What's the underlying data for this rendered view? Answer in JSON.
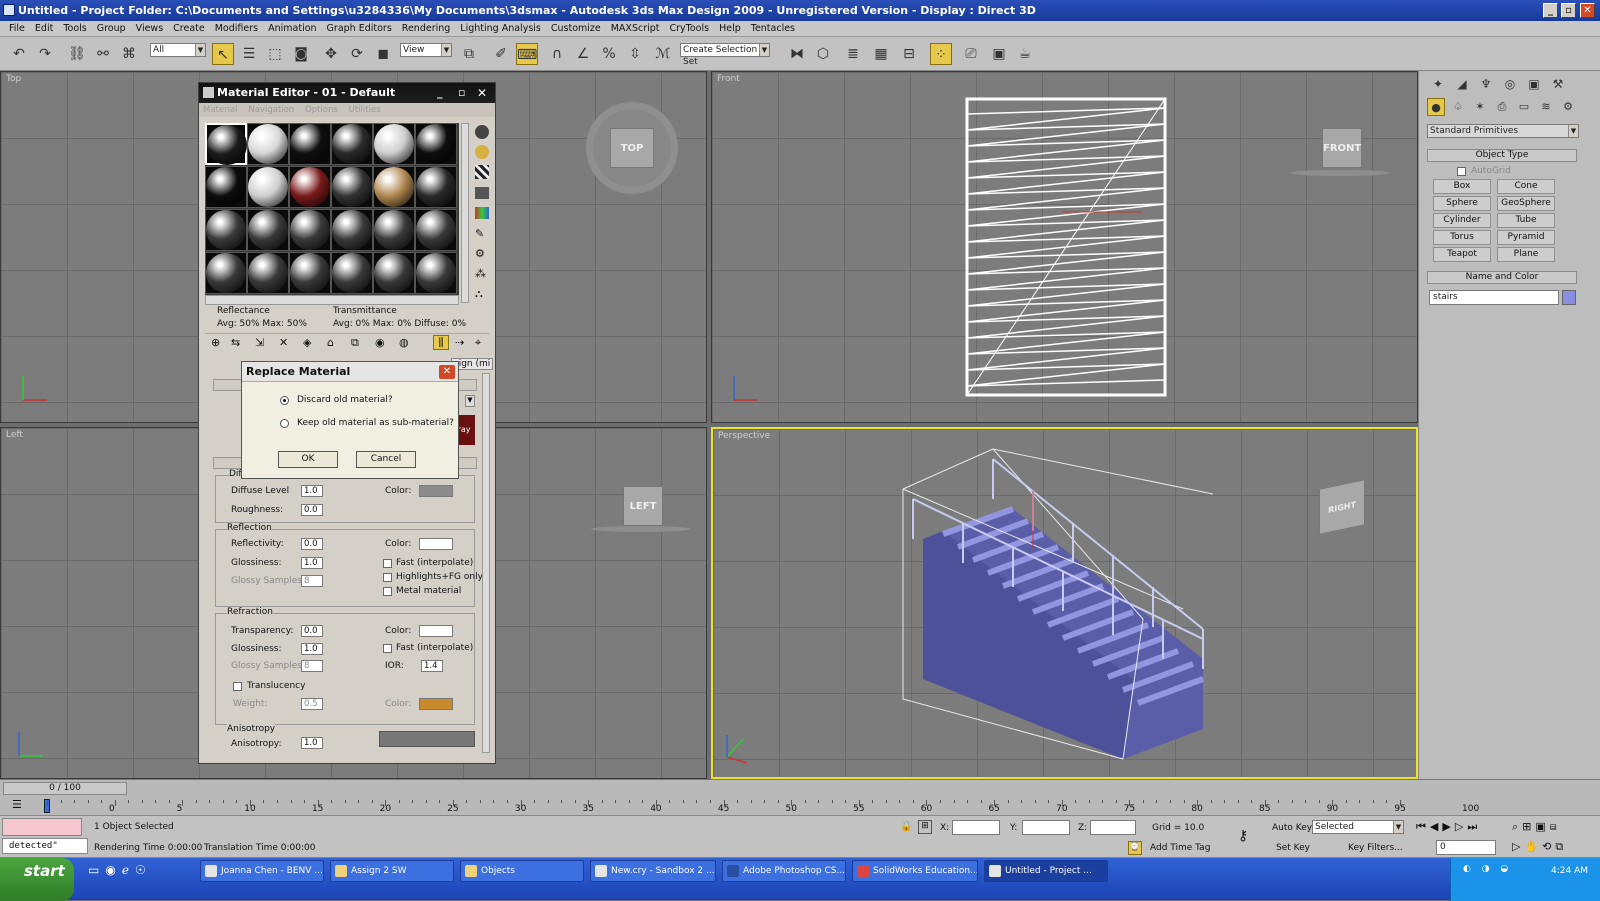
{
  "window": {
    "title": "Untitled     - Project Folder: C:\\Documents and Settings\\u3284336\\My Documents\\3dsmax    - Autodesk 3ds Max Design 2009    - Unregistered Version     - Display : Direct 3D"
  },
  "menu": [
    "File",
    "Edit",
    "Tools",
    "Group",
    "Views",
    "Create",
    "Modifiers",
    "Animation",
    "Graph Editors",
    "Rendering",
    "Lighting Analysis",
    "Customize",
    "MAXScript",
    "CryTools",
    "Help",
    "Tentacles"
  ],
  "toolbar": {
    "filter_value": "All",
    "coord_value": "View",
    "selection_set_placeholder": "Create Selection Set"
  },
  "viewports": {
    "top": "Top",
    "front": "Front",
    "left": "Left",
    "perspective": "Perspective",
    "cube_top": "TOP",
    "cube_front": "FRONT",
    "cube_left": "LEFT",
    "cube_right": "RIGHT"
  },
  "command_panel": {
    "category": "Standard Primitives",
    "object_type_header": "Object Type",
    "autogrid": "AutoGrid",
    "buttons": [
      "Box",
      "Cone",
      "Sphere",
      "GeoSphere",
      "Cylinder",
      "Tube",
      "Torus",
      "Pyramid",
      "Teapot",
      "Plane"
    ],
    "name_color_header": "Name and Color",
    "object_name": "stairs",
    "object_color": "#8a8ee0"
  },
  "material_editor": {
    "title": "Material Editor - 01 - Default",
    "menu": [
      "Material",
      "Navigation",
      "Options",
      "Utilities"
    ],
    "reflectance_label": "Reflectance",
    "reflectance_values": "Avg:  50% Max:  50%",
    "transmittance_label": "Transmittance",
    "transmittance_values": "Avg:   0% Max:     0%  Diffuse:    0%",
    "assign_fragment": "sign (mi",
    "ray_fragment": "ray",
    "diffuse_group": "Diffuse",
    "diffuse_level_label": "Diffuse Level",
    "diffuse_level": "1.0",
    "roughness_label": "Roughness:",
    "roughness": "0.0",
    "color_label": "Color:",
    "reflection_group": "Reflection",
    "reflectivity_label": "Reflectivity:",
    "reflectivity": "0.0",
    "glossiness_label": "Glossiness:",
    "glossiness": "1.0",
    "glossy_samples_label": "Glossy Samples:",
    "glossy_samples": "8",
    "fast_interp": "Fast (interpolate)",
    "highlights_fg": "Highlights+FG only",
    "metal_material": "Metal material",
    "refraction_group": "Refraction",
    "transparency_label": "Transparency:",
    "transparency": "0.0",
    "ref_glossiness": "1.0",
    "ref_glossy_samples": "8",
    "ior_label": "IOR:",
    "ior": "1.4",
    "translucency_label": "Translucency",
    "weight_label": "Weight:",
    "weight": "0.5",
    "anisotropy_group": "Anisotropy",
    "anisotropy_label": "Anisotropy:",
    "anisotropy": "1.0",
    "colors": {
      "diffuse": "#8c8c8c",
      "reflection": "#ffffff",
      "refraction": "#ffffff",
      "translucency": "#c88a2a"
    }
  },
  "replace_dialog": {
    "title": "Replace Material",
    "opt1": "Discard old material?",
    "opt2": "Keep old material as sub-material?",
    "ok": "OK",
    "cancel": "Cancel"
  },
  "timeline": {
    "frame": "0 / 100",
    "ticks": [
      "0",
      "5",
      "10",
      "15",
      "20",
      "25",
      "30",
      "35",
      "40",
      "45",
      "50",
      "55",
      "60",
      "65",
      "70",
      "75",
      "80",
      "85",
      "90",
      "95",
      "100"
    ]
  },
  "status": {
    "maxscript": "detected\"",
    "selected": "1 Object Selected",
    "rendering_time": "Rendering Time  0:00:00",
    "translation_time": "Translation Time  0:00:00",
    "x_label": "X:",
    "y_label": "Y:",
    "z_label": "Z:",
    "grid": "Grid = 10.0",
    "add_time_tag": "Add Time Tag",
    "auto_key": "Auto Key",
    "set_key": "Set Key",
    "key_mode": "Selected",
    "key_filters": "Key Filters...",
    "current_frame": "0"
  },
  "taskbar": {
    "start": "start",
    "tasks": [
      "Joanna Chen - BENV ...",
      "Assign 2 SW",
      "Objects",
      "New.cry - Sandbox 2 ...",
      "Adobe Photoshop CS...",
      "SolidWorks Education...",
      "Untitled     - Project ..."
    ],
    "clock": "4:24 AM"
  }
}
